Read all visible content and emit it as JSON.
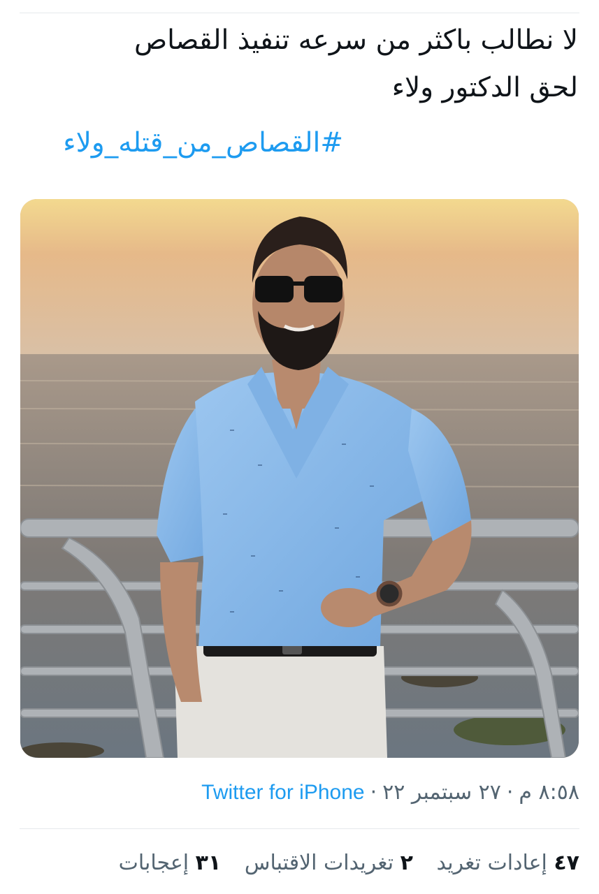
{
  "tweet": {
    "text_lines": [
      "لا نطالب باكثر من سرعه تنفيذ القصاص",
      "لحق الدكتور ولاء"
    ],
    "hashtag": "#القصاص_من_قتله_ولاء",
    "media": {
      "alt": "",
      "colors": {
        "sky_top": "#e9c98f",
        "sky_bottom": "#d9b88e",
        "sea": "#8f8478",
        "shirt": "#8ab8e8",
        "pants": "#e4e2dd",
        "rail": "#b4b8bc"
      }
    },
    "time": "٨:٥٨ م",
    "date": "٢٧ سبتمبر ٢٢",
    "source": "Twitter for iPhone",
    "separator": "·",
    "stats": [
      {
        "count": "٤٧",
        "label": "إعادات تغريد"
      },
      {
        "count": "٢",
        "label": "تغريدات الاقتباس"
      },
      {
        "count": "٣١",
        "label": "إعجابات"
      }
    ]
  }
}
